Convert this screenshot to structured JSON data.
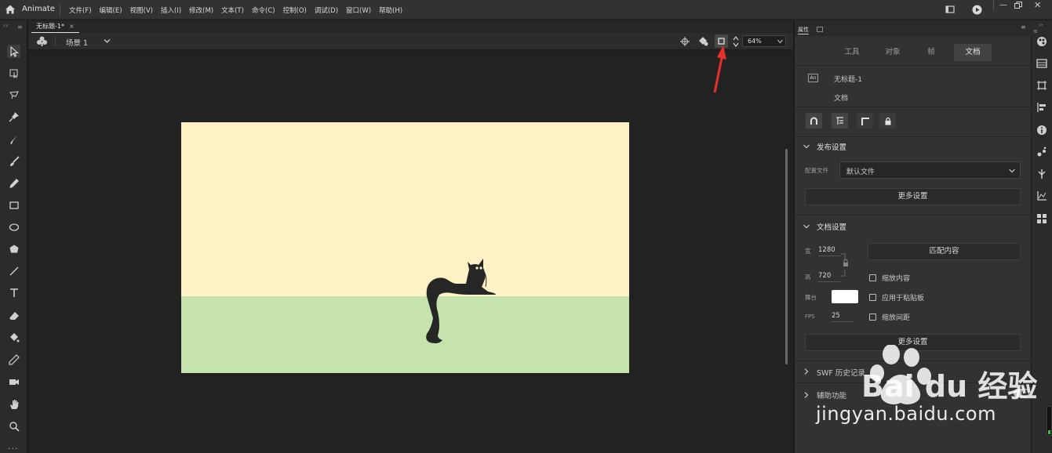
{
  "app": {
    "name": "Animate"
  },
  "menu": [
    "文件(F)",
    "编辑(E)",
    "视图(V)",
    "插入(I)",
    "修改(M)",
    "文本(T)",
    "命令(C)",
    "控制(O)",
    "调试(D)",
    "窗口(W)",
    "帮助(H)"
  ],
  "document_tab": {
    "title": "无标题-1*",
    "close": "×"
  },
  "scene": {
    "label": "场景 1"
  },
  "zoom": {
    "value": "64%"
  },
  "panel": {
    "header": "属性",
    "tabs": [
      "工具",
      "对象",
      "帧",
      "文档"
    ],
    "active_tab": "文档",
    "doc_icon": "An",
    "doc_name": "无标题-1",
    "doc_type": "文档",
    "publish": {
      "title": "发布设置",
      "profile_label": "配置文件",
      "profile_value": "默认文件",
      "more": "更多设置"
    },
    "doc_settings": {
      "title": "文档设置",
      "width_label": "宽",
      "width": "1280",
      "height_label": "高",
      "height": "720",
      "match_contents": "匹配内容",
      "scale_content": "缩放内容",
      "apply_pasteboard": "应用于粘贴板",
      "scale_spacing": "缩放间距",
      "stage_label": "舞台",
      "fps_label": "FPS",
      "fps": "25",
      "more": "更多设置"
    },
    "swf_history": "SWF 历史记录",
    "accessibility": "辅助功能"
  },
  "watermark": {
    "brand": "Bai du 经验",
    "url": "jingyan.baidu.com"
  },
  "colors": {
    "stage_sky": "#fff1c6",
    "stage_ground": "#c6e2ad",
    "arrow": "#e8302a"
  }
}
